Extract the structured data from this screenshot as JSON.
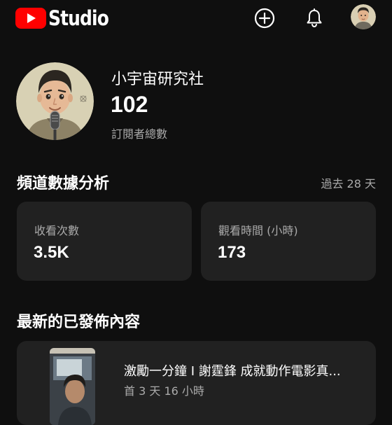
{
  "app": {
    "logo_text": "Studio"
  },
  "header": {
    "icons": [
      "youtube-logo-icon",
      "create-icon",
      "notifications-bell-icon",
      "account-avatar"
    ]
  },
  "channel": {
    "name": "小宇宙研究社",
    "subscriber_count": "102",
    "subscriber_label": "訂閱者總數"
  },
  "analytics": {
    "title": "頻道數據分析",
    "period": "過去 28 天",
    "cards": [
      {
        "label": "收看次數",
        "value": "3.5K"
      },
      {
        "label": "觀看時間 (小時)",
        "value": "173"
      }
    ]
  },
  "latest": {
    "title": "最新的已發佈內容",
    "video": {
      "title": "激勵一分鐘 I 謝霆鋒 成就動作電影真...",
      "age": "首 3 天 16 小時"
    }
  },
  "colors": {
    "background": "#0f0f0f",
    "card": "#212121",
    "brand_red": "#ff0000",
    "secondary_text": "#aaaaaa"
  }
}
